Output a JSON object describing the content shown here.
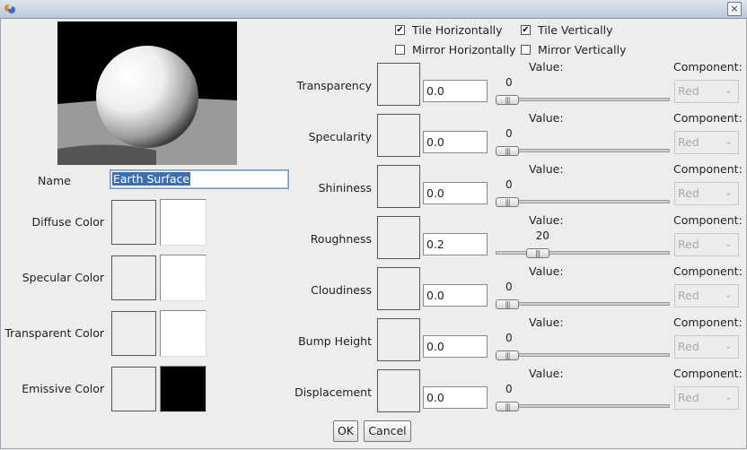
{
  "window": {
    "close_glyph": "×"
  },
  "left": {
    "name_label": "Name",
    "name_value": "Earth Surface",
    "colors": [
      {
        "label": "Diffuse Color",
        "color": "#ffffff"
      },
      {
        "label": "Specular Color",
        "color": "#ffffff"
      },
      {
        "label": "Transparent Color",
        "color": "#ffffff"
      },
      {
        "label": "Emissive Color",
        "color": "#000000"
      }
    ]
  },
  "options": {
    "tile_h": {
      "label": "Tile Horizontally",
      "checked": true
    },
    "tile_v": {
      "label": "Tile Vertically",
      "checked": true
    },
    "mirror_h": {
      "label": "Mirror Horizontally",
      "checked": false
    },
    "mirror_v": {
      "label": "Mirror Vertically",
      "checked": false
    }
  },
  "properties": [
    {
      "label": "Transparency",
      "value": "0.0",
      "value_label": "Value:",
      "slider": 0,
      "component_label": "Component:",
      "component": "Red"
    },
    {
      "label": "Specularity",
      "value": "0.0",
      "value_label": "Value:",
      "slider": 0,
      "component_label": "Component:",
      "component": "Red"
    },
    {
      "label": "Shininess",
      "value": "0.0",
      "value_label": "Value:",
      "slider": 0,
      "component_label": "Component:",
      "component": "Red"
    },
    {
      "label": "Roughness",
      "value": "0.2",
      "value_label": "Value:",
      "slider": 20,
      "component_label": "Component:",
      "component": "Red"
    },
    {
      "label": "Cloudiness",
      "value": "0.0",
      "value_label": "Value:",
      "slider": 0,
      "component_label": "Component:",
      "component": "Red"
    },
    {
      "label": "Bump Height",
      "value": "0.0",
      "value_label": "Value:",
      "slider": 0,
      "component_label": "Component:",
      "component": "Red"
    },
    {
      "label": "Displacement",
      "value": "0.0",
      "value_label": "Value:",
      "slider": 0,
      "component_label": "Component:",
      "component": "Red"
    }
  ],
  "buttons": {
    "ok": "OK",
    "cancel": "Cancel"
  },
  "colors": {
    "selection": "#3d6fb0",
    "focus_border": "#7f9db9"
  }
}
